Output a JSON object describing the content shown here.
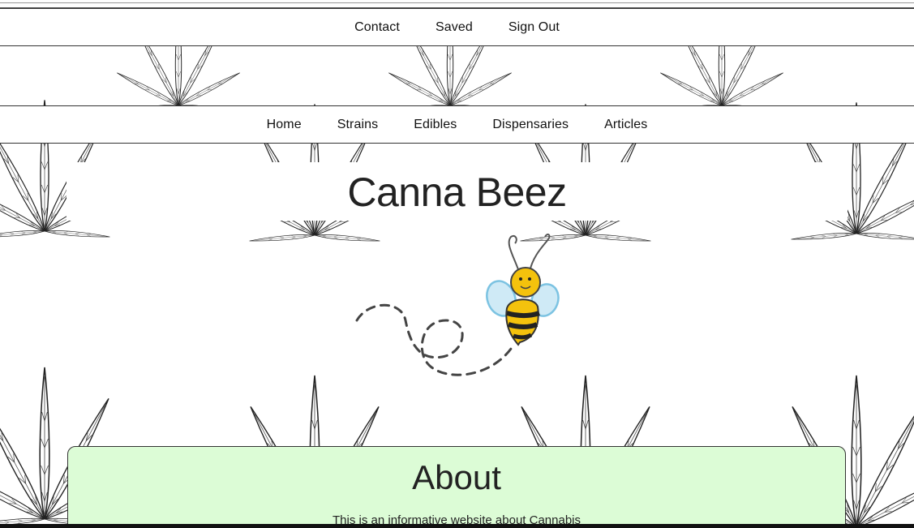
{
  "top_nav": {
    "items": [
      {
        "label": "Contact"
      },
      {
        "label": "Saved"
      },
      {
        "label": "Sign Out"
      }
    ]
  },
  "main_nav": {
    "items": [
      {
        "label": "Home"
      },
      {
        "label": "Strains"
      },
      {
        "label": "Edibles"
      },
      {
        "label": "Dispensaries"
      },
      {
        "label": "Articles"
      }
    ]
  },
  "site": {
    "title": "Canna Beez"
  },
  "hero": {
    "mascot_icon": "bee-icon",
    "trail_icon": "dashed-flight-path-icon",
    "bee_body_color": "#f4c20d",
    "bee_wing_color": "#a9d8ee"
  },
  "about": {
    "title": "About",
    "text": "This is an informative website about Cannabis",
    "background_color": "#dcfcd6"
  },
  "background": {
    "pattern_icon": "cannabis-leaf-icon"
  }
}
